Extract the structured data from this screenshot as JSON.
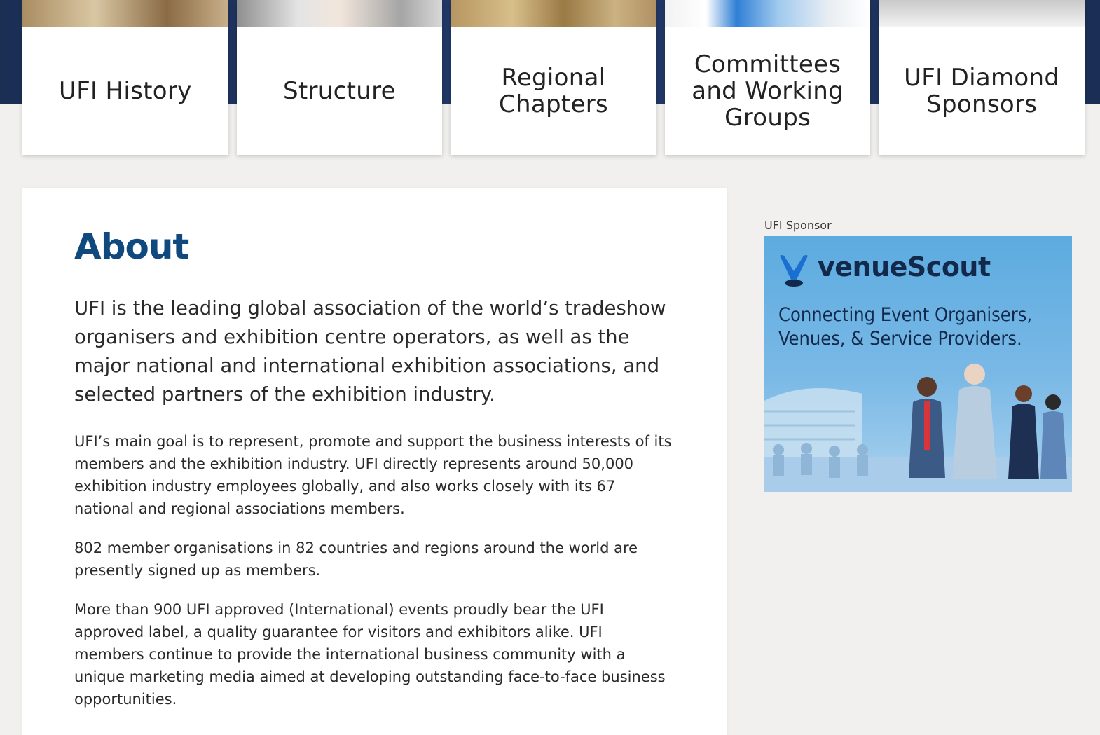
{
  "cards": [
    {
      "label": "UFI History"
    },
    {
      "label": "Structure"
    },
    {
      "label": "Regional Chapters"
    },
    {
      "label": "Committees and Working Groups"
    },
    {
      "label": "UFI Diamond Sponsors"
    }
  ],
  "about": {
    "title": "About",
    "lead": "UFI is the leading global association of the world’s tradeshow organisers and exhibition centre operators, as well as the major national and international exhibition associations, and selected partners of the exhibition industry.",
    "paragraphs": [
      "UFI’s main goal is to represent, promote and support the business interests of its members and the exhibition industry. UFI directly represents around 50,000 exhibition industry employees globally, and also works closely with its 67 national and regional associations members.",
      "802 member organisations in 82 countries and regions around the world are presently signed up as members.",
      "More than 900 UFI approved (International) events proudly bear the UFI approved label, a quality guarantee for visitors and exhibitors alike. UFI members continue to provide the international business community with a unique marketing media aimed at developing outstanding face-to-face business opportunities."
    ]
  },
  "sponsor": {
    "label": "UFI Sponsor",
    "brand": "venueScout",
    "tagline_1": "Connecting Event Organisers,",
    "tagline_2": "Venues, & Service Providers."
  },
  "colors": {
    "navy_band": "#1b2f55",
    "about_title": "#10497e",
    "ad_background": "#5cabe0",
    "page_background": "#f1f0ee"
  }
}
